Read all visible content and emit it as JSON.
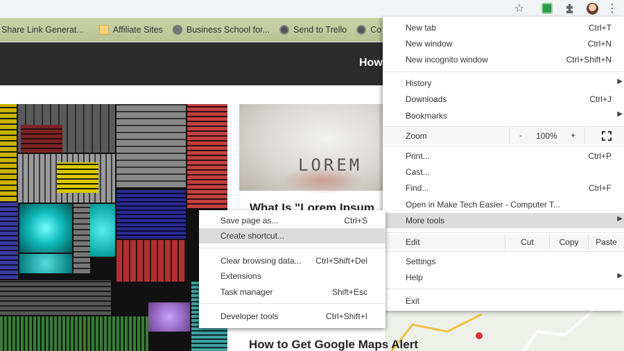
{
  "toolbar": {
    "icons": [
      "star-icon",
      "extension-green-icon",
      "puzzle-icon",
      "avatar",
      "kebab-menu-icon"
    ]
  },
  "bookmarks": [
    {
      "label": "Share Link Generat...",
      "icon": "none"
    },
    {
      "label": "Affiliate Sites",
      "icon": "folder-icon"
    },
    {
      "label": "Business School for...",
      "icon": "school-icon"
    },
    {
      "label": "Send to Trello",
      "icon": "globe-icon"
    },
    {
      "label": "Co",
      "icon": "globe-icon"
    }
  ],
  "site": {
    "header_text": "How",
    "lorem_word": "LOREM",
    "headline1": "What Is \"Lorem Ipsum",
    "headline2": "How to Get Google Maps Alert"
  },
  "menu": {
    "new_tab": {
      "label": "New tab",
      "shortcut": "Ctrl+T"
    },
    "new_window": {
      "label": "New window",
      "shortcut": "Ctrl+N"
    },
    "new_incognito": {
      "label": "New incognito window",
      "shortcut": "Ctrl+Shift+N"
    },
    "history": {
      "label": "History"
    },
    "downloads": {
      "label": "Downloads",
      "shortcut": "Ctrl+J"
    },
    "bookmarks": {
      "label": "Bookmarks"
    },
    "zoom": {
      "label": "Zoom",
      "minus": "-",
      "value": "100%",
      "plus": "+"
    },
    "print": {
      "label": "Print...",
      "shortcut": "Ctrl+P"
    },
    "cast": {
      "label": "Cast..."
    },
    "find": {
      "label": "Find...",
      "shortcut": "Ctrl+F"
    },
    "open_in": {
      "label": "Open in Make Tech Easier - Computer T..."
    },
    "more_tools": {
      "label": "More tools"
    },
    "edit": {
      "label": "Edit",
      "cut": "Cut",
      "copy": "Copy",
      "paste": "Paste"
    },
    "settings": {
      "label": "Settings"
    },
    "help": {
      "label": "Help"
    },
    "exit": {
      "label": "Exit"
    }
  },
  "submenu": {
    "save_page": {
      "label": "Save page as...",
      "shortcut": "Ctrl+S"
    },
    "create_shortcut": {
      "label": "Create shortcut..."
    },
    "clear_data": {
      "label": "Clear browsing data...",
      "shortcut": "Ctrl+Shift+Del"
    },
    "extensions": {
      "label": "Extensions"
    },
    "task_manager": {
      "label": "Task manager",
      "shortcut": "Shift+Esc"
    },
    "dev_tools": {
      "label": "Developer tools",
      "shortcut": "Ctrl+Shift+I"
    }
  },
  "colors": {
    "menu_highlight": "#dcdcdc",
    "bookmark_bar": "#c4cea0",
    "site_header": "#2b2b2b"
  }
}
